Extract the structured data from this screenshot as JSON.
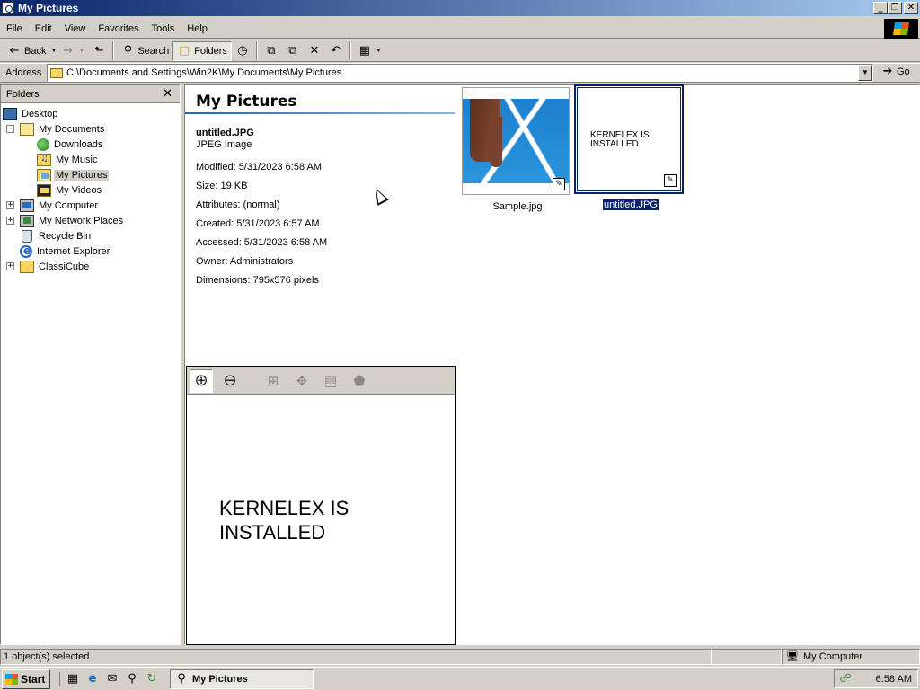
{
  "window": {
    "title": "My Pictures"
  },
  "menu": [
    "File",
    "Edit",
    "View",
    "Favorites",
    "Tools",
    "Help"
  ],
  "toolbar": {
    "back": "Back",
    "search": "Search",
    "folders": "Folders"
  },
  "address": {
    "label": "Address",
    "path": "C:\\Documents and Settings\\Win2K\\My Documents\\My Pictures",
    "go": "Go"
  },
  "folders_pane": {
    "title": "Folders",
    "items": [
      {
        "label": "Desktop"
      },
      {
        "label": "My Documents"
      },
      {
        "label": "Downloads"
      },
      {
        "label": "My Music"
      },
      {
        "label": "My Pictures"
      },
      {
        "label": "My Videos"
      },
      {
        "label": "My Computer"
      },
      {
        "label": "My Network Places"
      },
      {
        "label": "Recycle Bin"
      },
      {
        "label": "Internet Explorer"
      },
      {
        "label": "ClassiCube"
      }
    ]
  },
  "content": {
    "title": "My Pictures",
    "details": {
      "name": "untitled.JPG",
      "type": "JPEG Image",
      "modified": "Modified: 5/31/2023 6:58 AM",
      "size": "Size: 19 KB",
      "attributes": "Attributes: (normal)",
      "created": "Created: 5/31/2023 6:57 AM",
      "accessed": "Accessed: 5/31/2023 6:58 AM",
      "owner": "Owner: Administrators",
      "dimensions": "Dimensions: 795x576 pixels"
    },
    "preview_text_1": "KERNELEX IS",
    "preview_text_2": "INSTALLED",
    "files": [
      {
        "name": "Sample.jpg"
      },
      {
        "name": "untitled.JPG",
        "thumb_text_1": "KERNELEX IS",
        "thumb_text_2": "INSTALLED"
      }
    ]
  },
  "status": {
    "selection": "1 object(s) selected",
    "zone": "My Computer"
  },
  "taskbar": {
    "start": "Start",
    "task": "My Pictures",
    "clock": "6:58 AM"
  },
  "colors": {
    "title_start": "#0a246a",
    "title_end": "#a6caf0",
    "face": "#d4d0c8",
    "selection": "#0a246a"
  }
}
